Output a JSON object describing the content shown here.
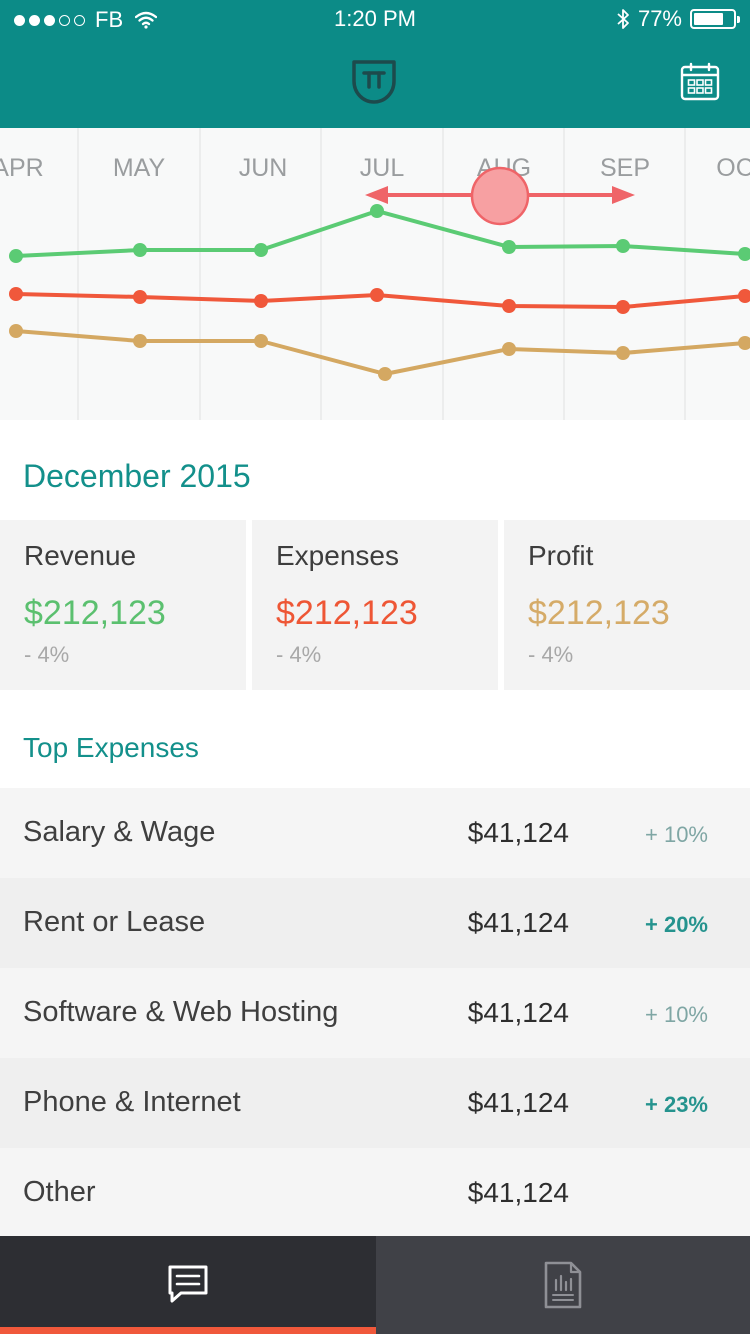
{
  "status_bar": {
    "carrier": "FB",
    "time": "1:20 PM",
    "battery": "77%",
    "battery_level": 0.77,
    "signal_bars_filled": 3,
    "signal_bars_total": 5
  },
  "header": {
    "logo_icon": "shield-logo-icon",
    "calendar_icon": "calendar-icon",
    "accent_color": "#0c8b87"
  },
  "chart_data": {
    "type": "line",
    "x": [
      "APR",
      "MAY",
      "JUN",
      "JUL",
      "AUG",
      "SEP",
      "OC"
    ],
    "selected_month": "AUG",
    "series": [
      {
        "color": "#5bcb74",
        "values": [
          256,
          250,
          250,
          211,
          247,
          246,
          254
        ]
      },
      {
        "color": "#f0583b",
        "values": [
          294,
          297,
          301,
          295,
          306,
          307,
          296
        ]
      },
      {
        "color": "#d4a862",
        "values": [
          331,
          341,
          341,
          374,
          349,
          353,
          343
        ]
      }
    ],
    "grid": true,
    "legend": "none"
  },
  "summary": {
    "period": "December 2015",
    "cards": [
      {
        "label": "Revenue",
        "value": "$212,123",
        "change": "- 4%",
        "color": "#5bc06f"
      },
      {
        "label": "Expenses",
        "value": "$212,123",
        "change": "- 4%",
        "color": "#ee5635"
      },
      {
        "label": "Profit",
        "value": "$212,123",
        "change": "- 4%",
        "color": "#d5ab68"
      }
    ]
  },
  "top_expenses": {
    "title": "Top Expenses",
    "rows": [
      {
        "name": "Salary & Wage",
        "amount": "$41,124",
        "change": "+ 10%",
        "strong": false
      },
      {
        "name": "Rent or Lease",
        "amount": "$41,124",
        "change": "+ 20%",
        "strong": true
      },
      {
        "name": "Software & Web Hosting",
        "amount": "$41,124",
        "change": "+ 10%",
        "strong": false
      },
      {
        "name": "Phone & Internet",
        "amount": "$41,124",
        "change": "+ 23%",
        "strong": true
      },
      {
        "name": "Other",
        "amount": "$41,124",
        "change": "",
        "strong": false
      }
    ]
  },
  "tabbar": {
    "tabs": [
      {
        "icon": "chat-bubble-icon",
        "active": true
      },
      {
        "icon": "report-document-icon",
        "active": false
      }
    ]
  }
}
